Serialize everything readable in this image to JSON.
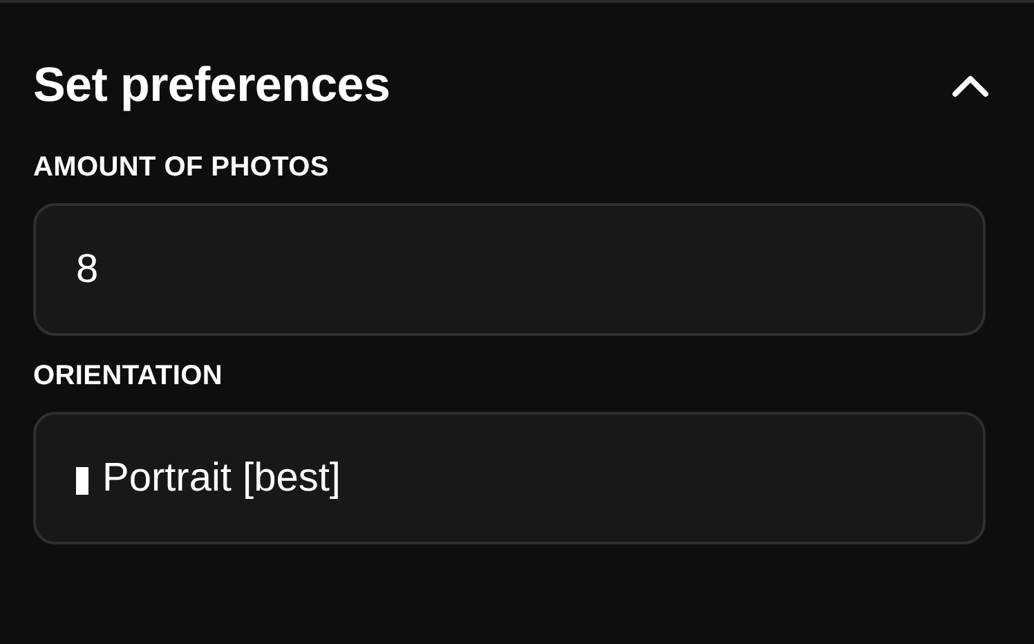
{
  "section": {
    "title": "Set preferences",
    "expanded": true
  },
  "fields": [
    {
      "kind": "input",
      "label": "AMOUNT OF PHOTOS",
      "value": "8"
    },
    {
      "kind": "select",
      "label": "ORIENTATION",
      "value": "Portrait [best]"
    }
  ]
}
